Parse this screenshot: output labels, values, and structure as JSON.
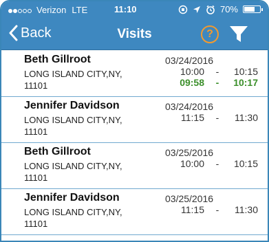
{
  "status_bar": {
    "carrier": "Verizon",
    "network": "LTE",
    "time": "11:10",
    "battery": "70%",
    "battery_level": 0.7,
    "signal_dots_filled": 2,
    "signal_dots_total": 5
  },
  "nav": {
    "back_label": "Back",
    "title": "Visits",
    "help_label": "?"
  },
  "colors": {
    "bar_blue": "#3e88c0",
    "help_orange": "#f39a2e",
    "actual_green": "#3b8f2a"
  },
  "visits": [
    {
      "name": "Beth Gillroot",
      "address_line1": "LONG ISLAND CITY,NY,",
      "address_line2": "11101",
      "date": "03/24/2016",
      "scheduled_start": "10:00",
      "scheduled_end": "10:15",
      "actual_start": "09:58",
      "actual_end": "10:17"
    },
    {
      "name": "Jennifer Davidson",
      "address_line1": "LONG ISLAND CITY,NY,",
      "address_line2": "11101",
      "date": "03/24/2016",
      "scheduled_start": "11:15",
      "scheduled_end": "11:30"
    },
    {
      "name": "Beth Gillroot",
      "address_line1": "LONG ISLAND CITY,NY,",
      "address_line2": "11101",
      "date": "03/25/2016",
      "scheduled_start": "10:00",
      "scheduled_end": "10:15"
    },
    {
      "name": "Jennifer Davidson",
      "address_line1": "LONG ISLAND CITY,NY,",
      "address_line2": "11101",
      "date": "03/25/2016",
      "scheduled_start": "11:15",
      "scheduled_end": "11:30"
    }
  ],
  "time_separator": "-"
}
